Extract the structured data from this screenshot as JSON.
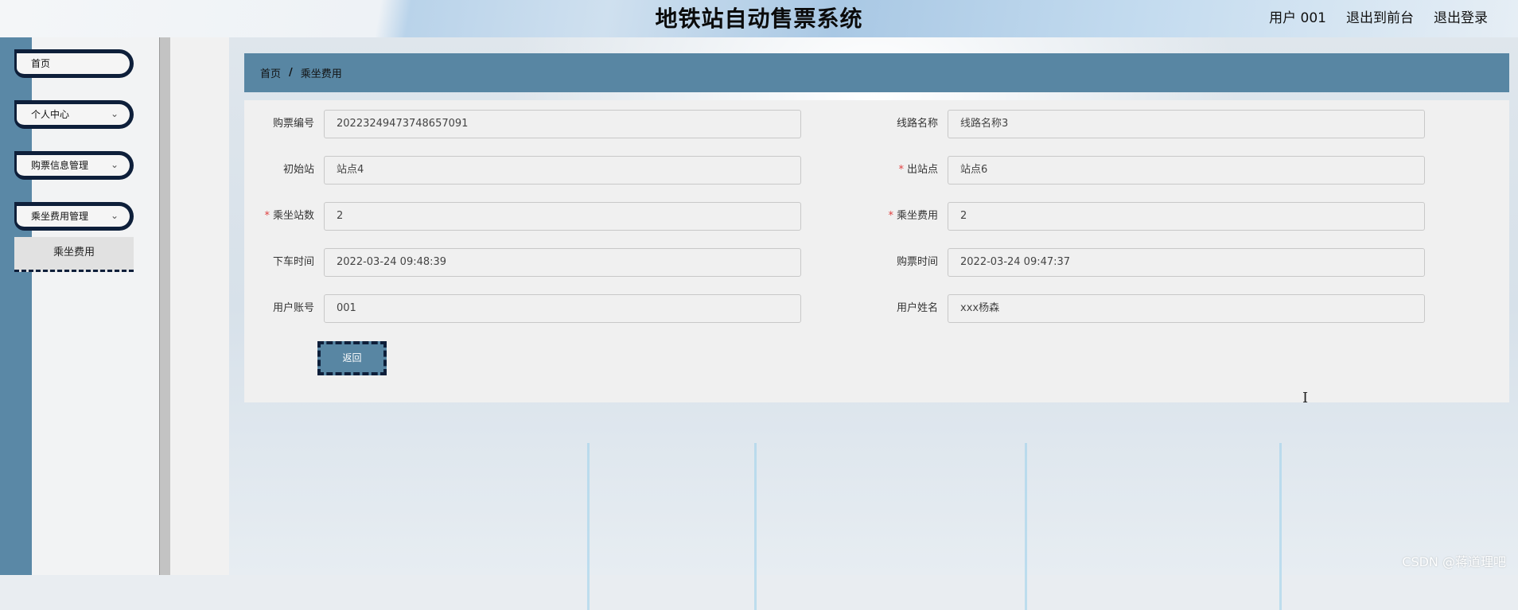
{
  "header": {
    "title": "地铁站自动售票系统",
    "links": [
      "用户 001",
      "退出到前台",
      "退出登录"
    ]
  },
  "sidebar": {
    "items": [
      {
        "label": "首页",
        "has_chevron": false
      },
      {
        "label": "个人中心",
        "has_chevron": true
      },
      {
        "label": "购票信息管理",
        "has_chevron": true
      },
      {
        "label": "乘坐费用管理",
        "has_chevron": true
      }
    ],
    "submenu_item": "乘坐费用"
  },
  "breadcrumb": {
    "home": "首页",
    "separator": "/",
    "current": "乘坐费用"
  },
  "form": {
    "fields": [
      {
        "label": "购票编号",
        "value": "20223249473748657091",
        "required": false
      },
      {
        "label": "线路名称",
        "value": "线路名称3",
        "required": false
      },
      {
        "label": "初始站",
        "value": "站点4",
        "required": false
      },
      {
        "label": "出站点",
        "value": "站点6",
        "required": true
      },
      {
        "label": "乘坐站数",
        "value": "2",
        "required": true
      },
      {
        "label": "乘坐费用",
        "value": "2",
        "required": true
      },
      {
        "label": "下车时间",
        "value": "2022-03-24 09:48:39",
        "required": false
      },
      {
        "label": "购票时间",
        "value": "2022-03-24 09:47:37",
        "required": false
      },
      {
        "label": "用户账号",
        "value": "001",
        "required": false
      },
      {
        "label": "用户姓名",
        "value": "xxx杨森",
        "required": false
      }
    ],
    "back_button": "返回",
    "required_mark": "*"
  },
  "watermark": "CSDN @蒋道理吧",
  "colors": {
    "accent": "#5886a3",
    "sidebar_strip": "#5a88a6",
    "menu_border": "#0e1f3a",
    "required": "#e04040"
  },
  "icons": {
    "chevron": "chevron-down-icon",
    "cursor": "text-cursor-icon"
  }
}
